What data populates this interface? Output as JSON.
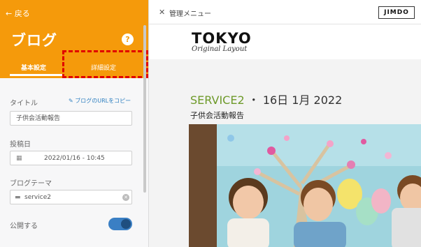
{
  "sidebar": {
    "back_label": "←  戻る",
    "title": "ブログ",
    "help_glyph": "?",
    "tabs": [
      {
        "label": "基本設定"
      },
      {
        "label": "詳細設定"
      }
    ],
    "fields": {
      "title_label": "タイトル",
      "copy_link": "✎ ブログのURLをコピー",
      "title_value": "子供会活動報告",
      "date_label": "投稿日",
      "date_value": "2022/01/16 - 10:45",
      "theme_label": "ブログテーマ",
      "theme_value": "service2",
      "publish_label": "公開する"
    },
    "publish_on": true
  },
  "topbar": {
    "close_glyph": "✕",
    "menu_label": "管理メニュー",
    "brand": "JIMDO"
  },
  "site": {
    "logo": "TOKYO",
    "logo_sub": "Original Layout"
  },
  "post": {
    "service": "SERVICE2",
    "date": "・ 16日 1月 2022",
    "subtitle": "子供会活動報告"
  },
  "icons": {
    "calendar": "calendar-icon",
    "folder": "folder-icon",
    "clear": "clear-icon",
    "pencil": "pencil-icon"
  },
  "colors": {
    "accent": "#f59a0b",
    "link": "#2d7fc0",
    "service": "#6e9a2a",
    "highlight": "#e10000",
    "toggle": "#3a7fc4"
  }
}
